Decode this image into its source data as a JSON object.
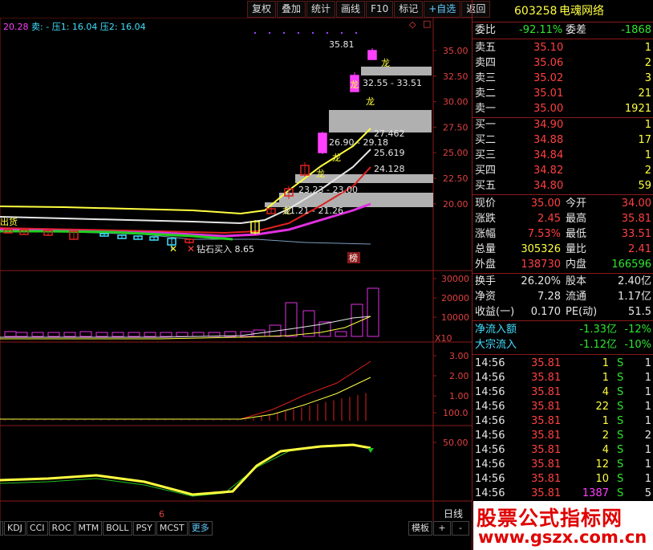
{
  "toolbar": {
    "items": [
      "复权",
      "叠加",
      "统计",
      "画线",
      "F10",
      "标记",
      "+自选",
      "返回"
    ]
  },
  "header": {
    "ma_text": "20.28",
    "sell_label": "卖:",
    "sell_value": "-",
    "press1": "压1: 16.04",
    "press2": "压2: 16.04",
    "diamond": "◇",
    "close_box": "□"
  },
  "price_axis": {
    "labels": [
      "35.00",
      "32.50",
      "30.00",
      "27.50",
      "25.00",
      "22.50",
      "20.00"
    ]
  },
  "volume_axis": {
    "labels": [
      "30000",
      "20000",
      "10000"
    ],
    "unit": "X10"
  },
  "macd_axis": {
    "labels": [
      "3.00",
      "2.00",
      "1.00"
    ]
  },
  "kdj_axis": {
    "labels": [
      "100.0",
      "50.00"
    ]
  },
  "annotations": {
    "high": "35.81",
    "lc_label": "龙",
    "zone1": "32.55 - 33.51",
    "zone2": "26.90 - 29.18",
    "zone3": "23.23 - 23.00",
    "zone4": "21.21 - 21.26",
    "l1": "27.462",
    "l2": "25.619",
    "l3": "24.128",
    "low": "钻石买入 8.65",
    "bang": "榜",
    "x_mark": "✕",
    "tail_left": "出货",
    "date_marker": "6"
  },
  "stock": {
    "code": "603258",
    "name": "电魂网络"
  },
  "weibi": {
    "label1": "委比",
    "value1": "-92.11%",
    "label2": "委差",
    "value2": "-1868"
  },
  "sell_orders": [
    {
      "label": "卖五",
      "price": "35.10",
      "vol": "1"
    },
    {
      "label": "卖四",
      "price": "35.06",
      "vol": "2"
    },
    {
      "label": "卖三",
      "price": "35.02",
      "vol": "3"
    },
    {
      "label": "卖二",
      "price": "35.01",
      "vol": "21"
    },
    {
      "label": "卖一",
      "price": "35.00",
      "vol": "1921"
    }
  ],
  "buy_orders": [
    {
      "label": "买一",
      "price": "34.90",
      "vol": "1"
    },
    {
      "label": "买二",
      "price": "34.88",
      "vol": "17"
    },
    {
      "label": "买三",
      "price": "34.84",
      "vol": "1"
    },
    {
      "label": "买四",
      "price": "34.82",
      "vol": "2"
    },
    {
      "label": "买五",
      "price": "34.80",
      "vol": "59"
    }
  ],
  "quote": [
    {
      "l1": "现价",
      "v1": "35.00",
      "l2": "今开",
      "v2": "34.00"
    },
    {
      "l1": "涨跌",
      "v1": "2.45",
      "l2": "最高",
      "v2": "35.81"
    },
    {
      "l1": "涨幅",
      "v1": "7.53%",
      "l2": "最低",
      "v2": "33.51"
    },
    {
      "l1": "总量",
      "v1": "305326",
      "l2": "量比",
      "v2": "2.41"
    },
    {
      "l1": "外盘",
      "v1": "138730",
      "l2": "内盘",
      "v2": "166596"
    }
  ],
  "fund": [
    {
      "l1": "换手",
      "v1": "26.20%",
      "l2": "股本",
      "v2": "2.40亿"
    },
    {
      "l1": "净资",
      "v1": "7.28",
      "l2": "流通",
      "v2": "1.17亿"
    },
    {
      "l1": "收益(一)",
      "v1": "0.170",
      "l2": "PE(动)",
      "v2": "51.5"
    }
  ],
  "flows": [
    {
      "label": "净流入额",
      "value": "-1.33亿",
      "pct": "-12%"
    },
    {
      "label": "大宗流入",
      "value": "-1.12亿",
      "pct": "-10%"
    }
  ],
  "ticks": [
    {
      "t": "14:56",
      "p": "35.81",
      "v": "1",
      "s": "S",
      "n": "1"
    },
    {
      "t": "14:56",
      "p": "35.81",
      "v": "1",
      "s": "S",
      "n": "1"
    },
    {
      "t": "14:56",
      "p": "35.81",
      "v": "4",
      "s": "S",
      "n": "1"
    },
    {
      "t": "14:56",
      "p": "35.81",
      "v": "22",
      "s": "S",
      "n": "1"
    },
    {
      "t": "14:56",
      "p": "35.81",
      "v": "1",
      "s": "S",
      "n": "1"
    },
    {
      "t": "14:56",
      "p": "35.81",
      "v": "2",
      "s": "S",
      "n": "2"
    },
    {
      "t": "14:56",
      "p": "35.81",
      "v": "4",
      "s": "S",
      "n": "1"
    },
    {
      "t": "14:56",
      "p": "35.81",
      "v": "12",
      "s": "S",
      "n": "1"
    },
    {
      "t": "14:56",
      "p": "35.81",
      "v": "10",
      "s": "S",
      "n": "1"
    },
    {
      "t": "14:56",
      "p": "35.81",
      "v": "1387",
      "s": "S",
      "n": "5"
    }
  ],
  "bottom": {
    "tabs": [
      "KDJ",
      "CCI",
      "ROC",
      "MTM",
      "BOLL",
      "PSY",
      "MCST",
      "更多"
    ],
    "period": "日线",
    "template": "模板",
    "plus": "+",
    "minus": "-"
  },
  "watermark": {
    "line1": "股票公式指标网",
    "line2": "www.gszx.com.cn"
  },
  "colors": {
    "up": "#ff40ff",
    "down": "#40e0ff",
    "frame": "#8b1a1a",
    "yellow": "#ffff40",
    "white": "#e6e6e6",
    "red": "#e02020",
    "magenta": "#e030e0",
    "green": "#20c020",
    "zone": "#b0b0b0"
  }
}
